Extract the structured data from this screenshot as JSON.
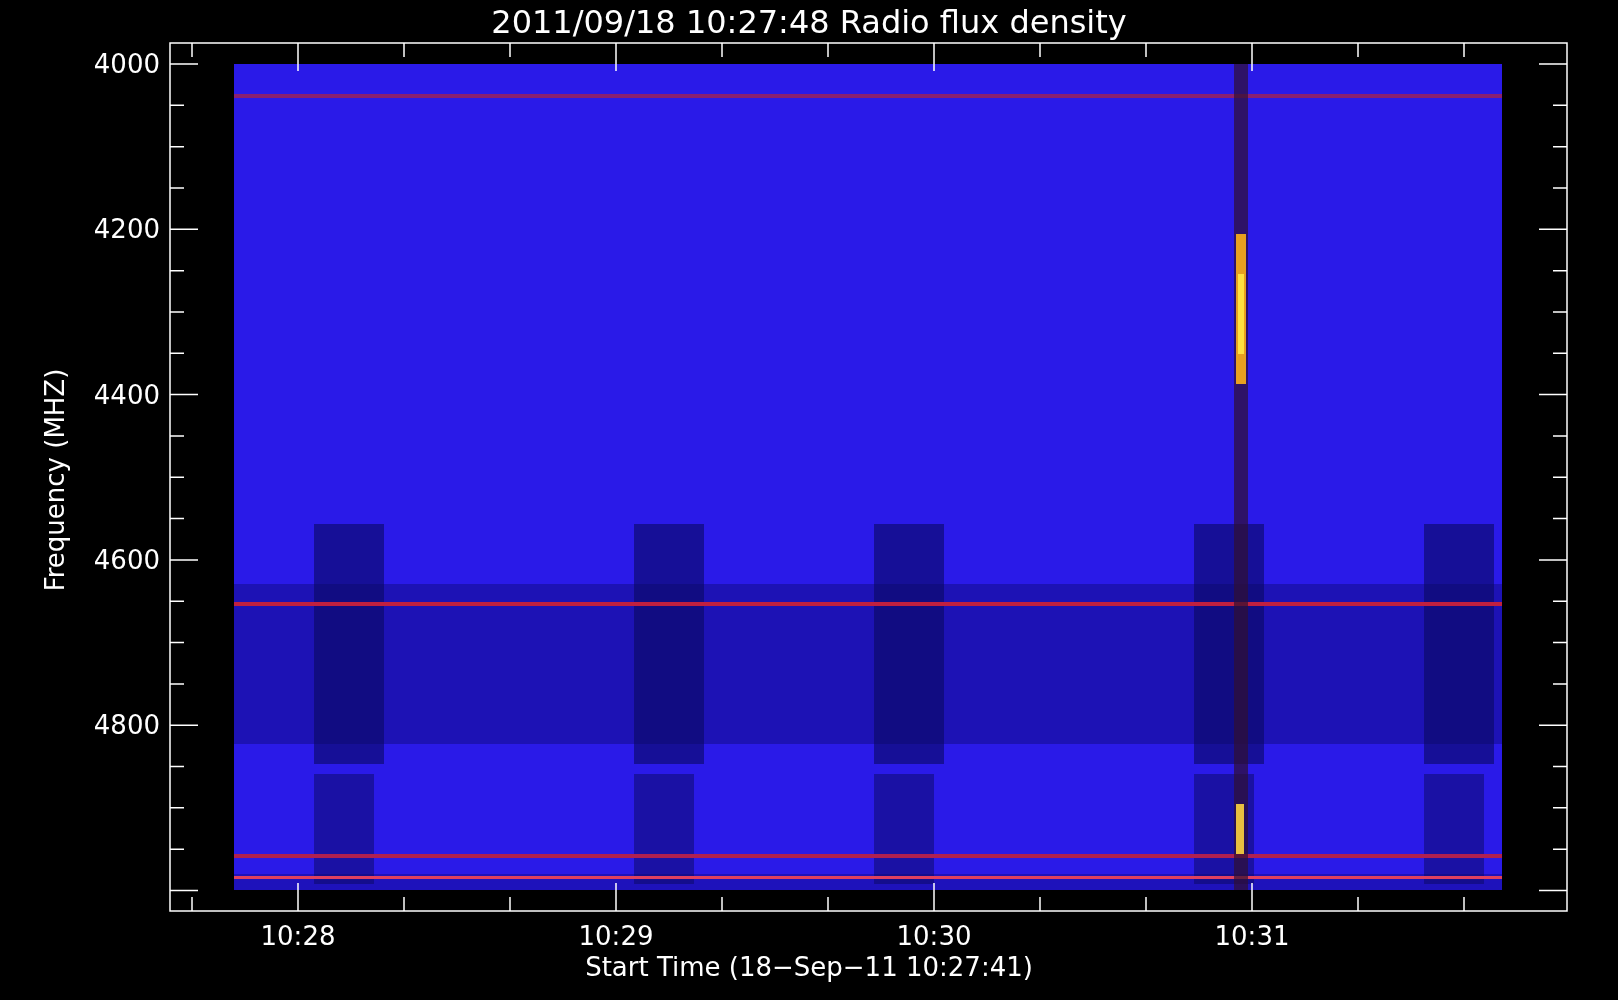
{
  "title": "2011/09/18 10:27:48 Radio flux density",
  "ylabel": "Frequency (MHZ)",
  "xlabel": "Start Time (18−Sep−11 10:27:41)",
  "yticks": [
    "4000",
    "4200",
    "4400",
    "4600",
    "4800"
  ],
  "xticks": [
    "10:28",
    "10:29",
    "10:30",
    "10:31"
  ]
}
